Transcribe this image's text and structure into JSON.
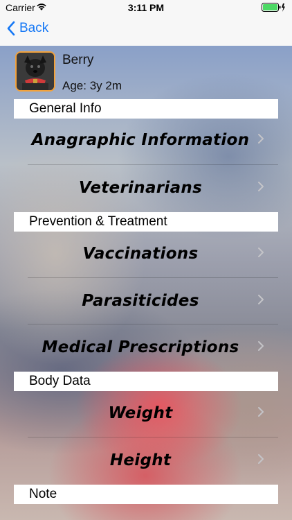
{
  "status": {
    "carrier": "Carrier",
    "time": "3:11 PM"
  },
  "nav": {
    "back_label": "Back"
  },
  "pet": {
    "name": "Berry",
    "age": "Age: 3y 2m"
  },
  "sections": {
    "general": "General Info",
    "prevention": "Prevention & Treatment",
    "body": "Body Data",
    "note": "Note"
  },
  "rows": {
    "anagraphic": "Anagraphic Information",
    "veterinarians": "Veterinarians",
    "vaccinations": "Vaccinations",
    "parasiticides": "Parasiticides",
    "prescriptions": "Medical Prescriptions",
    "weight": "Weight",
    "height": "Height"
  },
  "colors": {
    "accent": "#1477f5",
    "avatar_border": "#f3a23b",
    "battery": "#4cd964"
  }
}
